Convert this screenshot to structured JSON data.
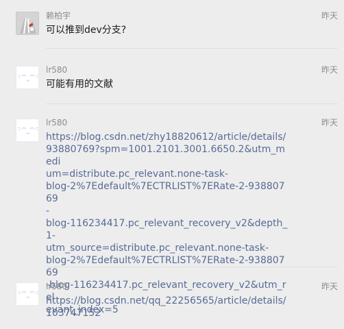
{
  "messages": [
    {
      "sender": "赖柏宇",
      "time": "昨天",
      "text": "可以推到dev分支?",
      "avatar_icon": "photo-avatar-icon"
    },
    {
      "sender": "lr580",
      "time": "昨天",
      "text": "可能有用的文献",
      "avatar_icon": "sleepy-face-avatar-icon"
    },
    {
      "sender": "lr580",
      "time": "昨天",
      "lines": [
        "https://blog.csdn.net/zhy18820612/article/details/",
        "93880769?spm=1001.2101.3001.6650.2&utm_medi",
        "um=distribute.pc_relevant.none-task-",
        "blog-2%7Edefault%7ECTRLIST%7ERate-2-93880769",
        "-",
        "blog-116234417.pc_relevant_recovery_v2&depth_1-",
        "utm_source=distribute.pc_relevant.none-task-",
        "blog-2%7Edefault%7ECTRLIST%7ERate-2-93880769",
        "-blog-116234417.pc_relevant_recovery_v2&utm_rel",
        "evant_index=5"
      ],
      "avatar_icon": "sleepy-face-avatar-icon"
    },
    {
      "sender": "lr580",
      "time": "昨天",
      "lines": [
        "https://blog.csdn.net/qq_22256565/article/details/",
        "103747152"
      ],
      "avatar_icon": "sleepy-face-avatar-icon"
    }
  ],
  "colors": {
    "background": "#ededed",
    "text": "#1a1a1a",
    "meta": "#8c8c8c",
    "link": "#576b95",
    "divider": "#dedede"
  }
}
